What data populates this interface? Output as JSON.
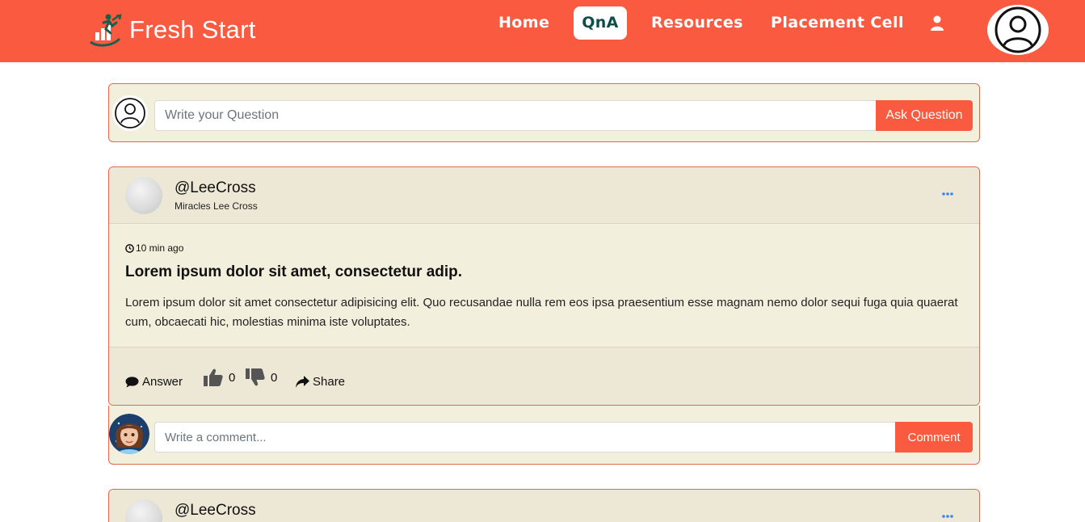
{
  "brand": {
    "name": "Fresh Start",
    "logo_icon": "running-growth-logo-icon"
  },
  "nav": {
    "items": [
      {
        "label": "Home",
        "active": false
      },
      {
        "label": "QnA",
        "active": true
      },
      {
        "label": "Resources",
        "active": false
      },
      {
        "label": "Placement Cell",
        "active": false
      }
    ],
    "user_icon": "user-icon",
    "profile_icon": "profile-avatar-icon"
  },
  "ask": {
    "placeholder": "Write your Question",
    "button_label": "Ask Question",
    "avatar_icon": "user-circle-icon"
  },
  "posts": [
    {
      "username": "@LeeCross",
      "fullname": "Miracles Lee Cross",
      "menu_icon": "ellipsis-icon",
      "time": "10 min ago",
      "time_icon": "clock-icon",
      "title": "Lorem ipsum dolor sit amet, consectetur adip.",
      "body": "Lorem ipsum dolor sit amet consectetur adipisicing elit. Quo recusandae nulla rem eos ipsa praesentium esse magnam nemo dolor sequi fuga quia quaerat cum, obcaecati hic, molestias minima iste voluptates.",
      "actions": {
        "answer_label": "Answer",
        "likes": "0",
        "dislikes": "0",
        "share_label": "Share"
      },
      "comment": {
        "placeholder": "Write a comment...",
        "button_label": "Comment"
      }
    },
    {
      "username": "@LeeCross",
      "menu_icon": "ellipsis-icon"
    }
  ],
  "colors": {
    "primary": "#fa5b40",
    "active_text": "#0f4d4a",
    "card_bg": "#f3efdd",
    "card_header_bg": "#ede7d5",
    "card_border": "#e06a50",
    "menu_dots": "#3b82f6"
  }
}
